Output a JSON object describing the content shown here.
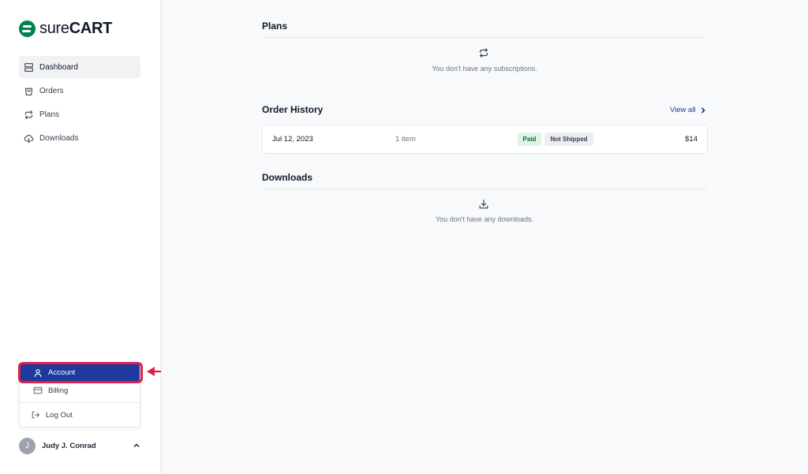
{
  "brand": {
    "light": "sure",
    "bold": "CART",
    "color": "#00824c"
  },
  "sidebar": {
    "items": [
      {
        "label": "Dashboard",
        "icon": "server-icon",
        "active": true
      },
      {
        "label": "Orders",
        "icon": "shopping-bag-icon"
      },
      {
        "label": "Plans",
        "icon": "repeat-icon"
      },
      {
        "label": "Downloads",
        "icon": "cloud-download-icon"
      }
    ]
  },
  "account_menu": {
    "account": "Account",
    "billing": "Billing",
    "logout": "Log Out"
  },
  "user": {
    "initial": "J",
    "name": "Judy J. Conrad"
  },
  "plans": {
    "title": "Plans",
    "empty": "You don't have any subscriptions."
  },
  "order_history": {
    "title": "Order History",
    "view_all": "View all",
    "orders": [
      {
        "date": "Jul 12, 2023",
        "items": "1 item",
        "payment_status": "Paid",
        "shipping_status": "Not Shipped",
        "total": "$14"
      }
    ]
  },
  "downloads": {
    "title": "Downloads",
    "empty": "You don't have any downloads."
  },
  "colors": {
    "accent": "#1e3a9f",
    "highlight": "#e11d48",
    "paid_bg": "#dcf5e6"
  }
}
